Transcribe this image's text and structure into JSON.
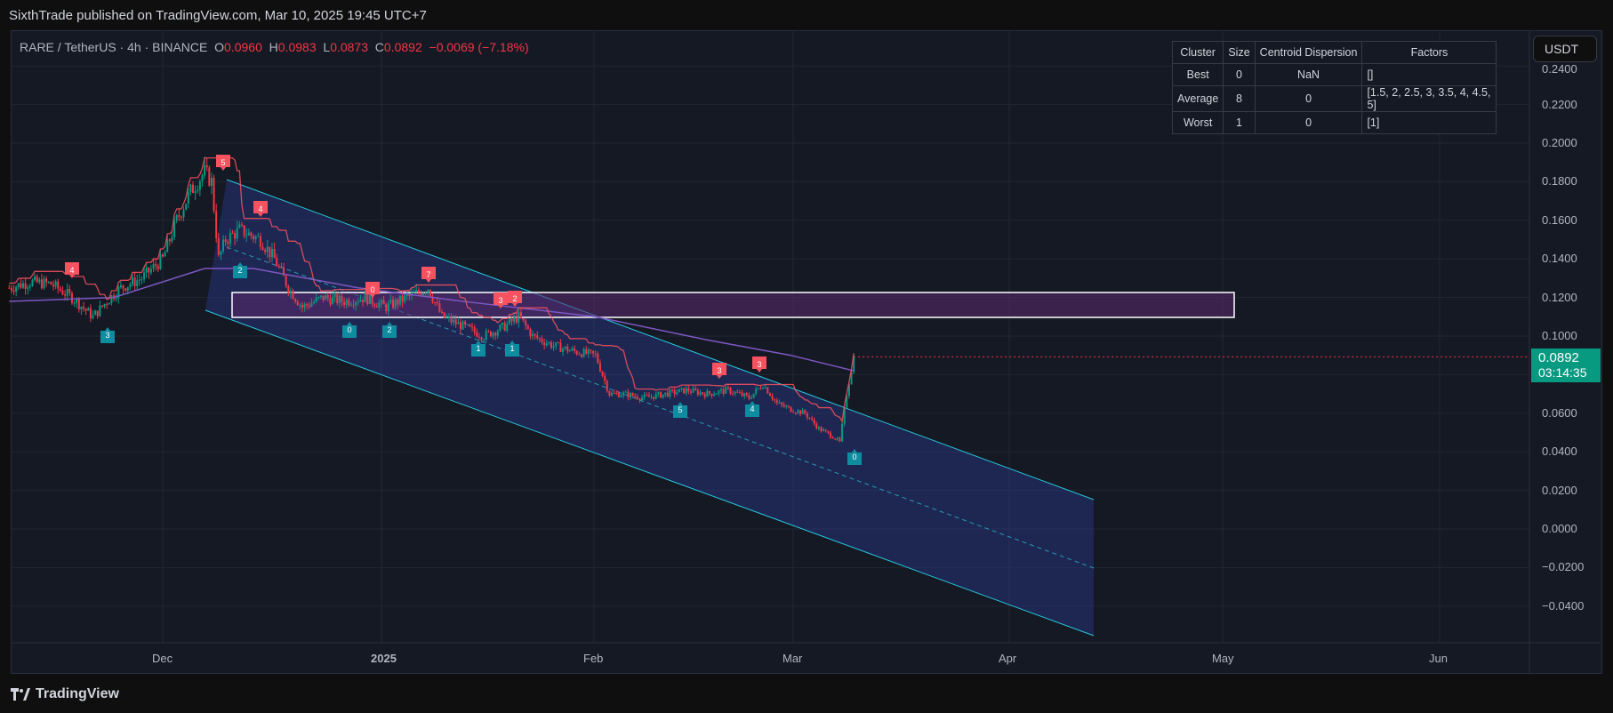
{
  "header": {
    "published": "SixthTrade published on TradingView.com, Mar 10, 2025 19:45 UTC+7"
  },
  "legend": {
    "symbol": "RARE / TetherUS · 4h · BINANCE",
    "o_label": "O",
    "o": "0.0960",
    "h_label": "H",
    "h": "0.0983",
    "l_label": "L",
    "l": "0.0873",
    "c_label": "C",
    "c": "0.0892",
    "change": "−0.0069 (−7.18%)"
  },
  "currency_button": "USDT",
  "price_tag": {
    "price": "0.0892",
    "countdown": "03:14:35"
  },
  "cluster_table": {
    "headers": [
      "Cluster",
      "Size",
      "Centroid Dispersion",
      "Factors"
    ],
    "rows": [
      [
        "Best",
        "0",
        "NaN",
        "[]"
      ],
      [
        "Average",
        "8",
        "0",
        "[1.5, 2, 2.5, 3, 3.5, 4, 4.5, 5]"
      ],
      [
        "Worst",
        "1",
        "0",
        "[1]"
      ]
    ]
  },
  "footer": {
    "brand": "TradingView"
  },
  "colors": {
    "up": "#089981",
    "down": "#f23645",
    "ma": "#7e57c2",
    "supertrend_bear": "#f7525f",
    "supertrend_bull": "#22ab94",
    "channel": "#26c6da"
  },
  "chart_data": {
    "type": "candlestick",
    "price_axis": [
      "0.2400",
      "0.2200",
      "0.2000",
      "0.1800",
      "0.1600",
      "0.1400",
      "0.1200",
      "0.1000",
      "0.0600",
      "0.0400",
      "0.0200",
      "0.0000",
      "−0.0200",
      "−0.0400"
    ],
    "time_axis": [
      "Dec",
      "2025",
      "Feb",
      "Mar",
      "Apr",
      "May",
      "Jun"
    ],
    "ylim": [
      -0.056,
      0.246
    ],
    "closes_by_day": [
      [
        0,
        0.125
      ],
      [
        3,
        0.128
      ],
      [
        6,
        0.127
      ],
      [
        9,
        0.12
      ],
      [
        12,
        0.11
      ],
      [
        14,
        0.118
      ],
      [
        16,
        0.125
      ],
      [
        19,
        0.13
      ],
      [
        22,
        0.14
      ],
      [
        24,
        0.16
      ],
      [
        26,
        0.175
      ],
      [
        28,
        0.185
      ],
      [
        29,
        0.18
      ],
      [
        30,
        0.14
      ],
      [
        31,
        0.15
      ],
      [
        33,
        0.155
      ],
      [
        36,
        0.15
      ],
      [
        38,
        0.14
      ],
      [
        40,
        0.125
      ],
      [
        42,
        0.115
      ],
      [
        45,
        0.12
      ],
      [
        48,
        0.118
      ],
      [
        51,
        0.12
      ],
      [
        54,
        0.115
      ],
      [
        57,
        0.12
      ],
      [
        60,
        0.125
      ],
      [
        62,
        0.11
      ],
      [
        65,
        0.105
      ],
      [
        68,
        0.1
      ],
      [
        71,
        0.105
      ],
      [
        73,
        0.11
      ],
      [
        75,
        0.1
      ],
      [
        78,
        0.095
      ],
      [
        81,
        0.092
      ],
      [
        84,
        0.09
      ],
      [
        86,
        0.07
      ],
      [
        88,
        0.07
      ],
      [
        91,
        0.068
      ],
      [
        94,
        0.07
      ],
      [
        97,
        0.072
      ],
      [
        100,
        0.07
      ],
      [
        103,
        0.072
      ],
      [
        106,
        0.068
      ],
      [
        108,
        0.075
      ],
      [
        110,
        0.065
      ],
      [
        112,
        0.062
      ],
      [
        114,
        0.06
      ],
      [
        116,
        0.052
      ],
      [
        118,
        0.048
      ],
      [
        119,
        0.045
      ],
      [
        120,
        0.07
      ],
      [
        121,
        0.0892
      ]
    ],
    "ma_by_day": [
      [
        0,
        0.118
      ],
      [
        15,
        0.12
      ],
      [
        28,
        0.135
      ],
      [
        35,
        0.135
      ],
      [
        50,
        0.125
      ],
      [
        65,
        0.118
      ],
      [
        84,
        0.11
      ],
      [
        100,
        0.098
      ],
      [
        112,
        0.09
      ],
      [
        121,
        0.082
      ]
    ],
    "signals": [
      {
        "text": "4",
        "type": "bear"
      },
      {
        "text": "5",
        "type": "bear"
      },
      {
        "text": "4",
        "type": "bear"
      },
      {
        "text": "0",
        "type": "bear"
      },
      {
        "text": "7",
        "type": "bear"
      },
      {
        "text": "3",
        "type": "bear"
      },
      {
        "text": "2",
        "type": "bear"
      },
      {
        "text": "3",
        "type": "bear"
      },
      {
        "text": "3",
        "type": "bear"
      },
      {
        "text": "3",
        "type": "bull"
      },
      {
        "text": "2",
        "type": "bull"
      },
      {
        "text": "0",
        "type": "bull"
      },
      {
        "text": "2",
        "type": "bull"
      },
      {
        "text": "1",
        "type": "bull"
      },
      {
        "text": "1",
        "type": "bull"
      },
      {
        "text": "5",
        "type": "bull"
      },
      {
        "text": "4",
        "type": "bull"
      },
      {
        "text": "0",
        "type": "bull"
      }
    ]
  }
}
